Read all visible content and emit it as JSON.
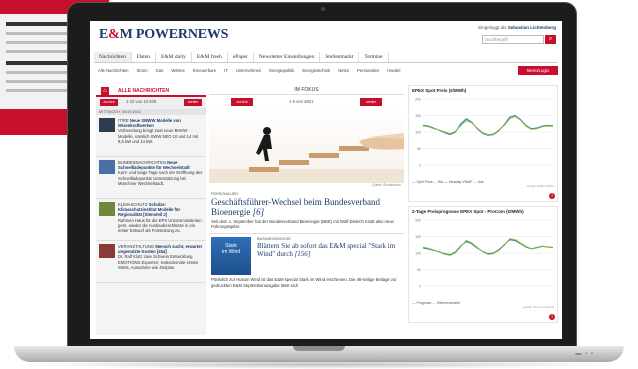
{
  "site": {
    "logo_a": "E",
    "logo_amp": "&",
    "logo_b": "M POWERNEWS",
    "login_prefix": "Eingeloggt als",
    "login_user": "Sebastian Lichtenberg",
    "search_placeholder": "Suchbegriff"
  },
  "nav": [
    "Nachrichten",
    "Daten",
    "E&M daily",
    "E&M fresh",
    "ePaper",
    "Newsletter Einstellungen",
    "Stellenmarkt",
    "Termine"
  ],
  "subnav": [
    "Alle Nachrichten",
    "Strom",
    "Gas",
    "Wärme",
    "Erneuerbare",
    "IT",
    "Unternehmen",
    "Energiepolitik",
    "Energietechnik",
    "Netze",
    "Personalien",
    "Handel"
  ],
  "menu_login": "Menü/Login",
  "left": {
    "title": "ALLE NACHRICHTEN",
    "prev": "zurück",
    "next": "weiter",
    "page": "1-10 von 10.609",
    "date": "MITTWOCH, 08.09.2021",
    "news": [
      {
        "kicker": "IT/RE",
        "title": "Neue SMWW Modelle von Wisenkraftwerken",
        "body": "Vorbereitung bringt zwei neue BHKW-Modelle, nämlich SWW NEO 10 und 14 mit 9,5 kW und 14 kW.",
        "img": "#2c3e50"
      },
      {
        "kicker": "BUNDESNACHRICHTEN",
        "title": "Neue Schnellladepunkte für Wechselstadt",
        "body": "Kurz- und lange Tage nach der Eröffnung des Schnellladepunkts Unterstützung bei Münchner Wechselstadt.",
        "img": "#4a6fa5"
      },
      {
        "kicker": "KLIMASCHUTZ",
        "title": "Schulze: Klimaschutzinstitut Modelle für Regionalität [Stenoteil 2]",
        "body": "Rahmen Haus für die EPS Unionsministerien gern, wieder die Ausbaubeschlüsse in ein erster Entwurf als Fortsetzung zu.",
        "img": "#6d8a3a"
      },
      {
        "kicker": "VERANSTALTUNG",
        "title": "Mensch sucht, erwartet ungenutzte Kosten [454]",
        "body": "Dr. Ralf Klotz Uwe Schwein Entwicklung EMOTIONS Experten; Kalendernote erstes Webs, Ausnahme wie Zeitplan.",
        "img": "#8b3a3a"
      }
    ]
  },
  "middle": {
    "section": "IM FOKUS",
    "prev": "zurück",
    "next": "weiter",
    "page": "1-5 von 4821",
    "credit": "Quelle: Shutterstock",
    "kicker": "PERSONALIEN",
    "headline": "Geschäftsführer-Wechsel beim Bundesverband Bioenergie",
    "headline_tag": "[6]",
    "teaser": "Seit dem 1. September hat der Bundesverband Bioenergie (BBE) mit Wolf-Dietrich Kindt also neue Führungsspitze",
    "special_image_text_1": "Stark",
    "special_image_text_2": "im Wind",
    "special_kicker": "BUSINESSWOCHE",
    "special_headline": "Blättern Sie ab sofort das E&M special \"Stark im Wind\" durch",
    "special_tag": "[156]",
    "special_teaser": "Pünktlich zur Husum Wind ist das E&M special Stark im Wind erschienen. Die 48-seitige Beilage zur gedruckten E&M Septemberausgabe lässt sich"
  },
  "right": {
    "chart1_title": "EPEX Spot Preis (€/MWh)",
    "chart1_legend": [
      "Spot Preis",
      "Bid",
      "Intraday VWAP",
      "Ask"
    ],
    "chart1_source": "Quelle: EPEX SPOT",
    "chart2_title": "2-Tage Preisprognose EPEX Spot - ProCom (€/MWh)",
    "chart2_legend": [
      "Prognose",
      "Referenzmarkt"
    ],
    "chart2_source": "Quelle: ProCom GmbH"
  },
  "colors": {
    "brand": "#c8102e",
    "navy": "#1a3a6b",
    "series1": "#2c6fb6",
    "series2": "#8fbf2f",
    "series3": "#1a1a1a"
  },
  "chart_data": [
    {
      "type": "line",
      "title": "EPEX Spot Preis (€/MWh)",
      "x": [
        0,
        1,
        2,
        3,
        4,
        5,
        6,
        7,
        8,
        9,
        10,
        11,
        12,
        13,
        14,
        15,
        16,
        17,
        18,
        19,
        20,
        21,
        22,
        23,
        24
      ],
      "series": [
        {
          "name": "Spot Preis",
          "values": [
            120,
            118,
            112,
            105,
            98,
            92,
            100,
            125,
            140,
            130,
            110,
            96,
            90,
            92,
            104,
            122,
            145,
            150,
            138,
            120,
            110,
            112,
            118,
            120,
            119
          ]
        },
        {
          "name": "Intraday VWAP",
          "values": [
            118,
            116,
            110,
            106,
            100,
            95,
            102,
            120,
            135,
            128,
            112,
            98,
            92,
            94,
            106,
            120,
            140,
            147,
            136,
            118,
            108,
            110,
            116,
            118,
            117
          ]
        }
      ],
      "xlabel": "",
      "ylabel": "",
      "ylim": [
        0,
        200
      ],
      "grid": true,
      "legend": "bottom"
    },
    {
      "type": "line",
      "title": "2-Tage Preisprognose EPEX Spot - ProCom (€/MWh)",
      "x": [
        0,
        1,
        2,
        3,
        4,
        5,
        6,
        7,
        8,
        9,
        10,
        11,
        12,
        13,
        14,
        15,
        16,
        17,
        18,
        19,
        20,
        21,
        22,
        23,
        24
      ],
      "series": [
        {
          "name": "Prognose",
          "values": [
            115,
            112,
            108,
            104,
            98,
            95,
            103,
            122,
            135,
            128,
            115,
            105,
            98,
            100,
            110,
            125,
            140,
            138,
            128,
            118,
            112,
            116,
            120,
            118,
            116
          ]
        },
        {
          "name": "Referenzmarkt",
          "values": [
            118,
            114,
            109,
            103,
            96,
            93,
            101,
            120,
            138,
            131,
            117,
            104,
            96,
            98,
            108,
            123,
            143,
            141,
            130,
            120,
            113,
            117,
            121,
            119,
            117
          ]
        }
      ],
      "xlabel": "",
      "ylabel": "",
      "ylim": [
        0,
        200
      ],
      "grid": true,
      "legend": "bottom"
    }
  ]
}
